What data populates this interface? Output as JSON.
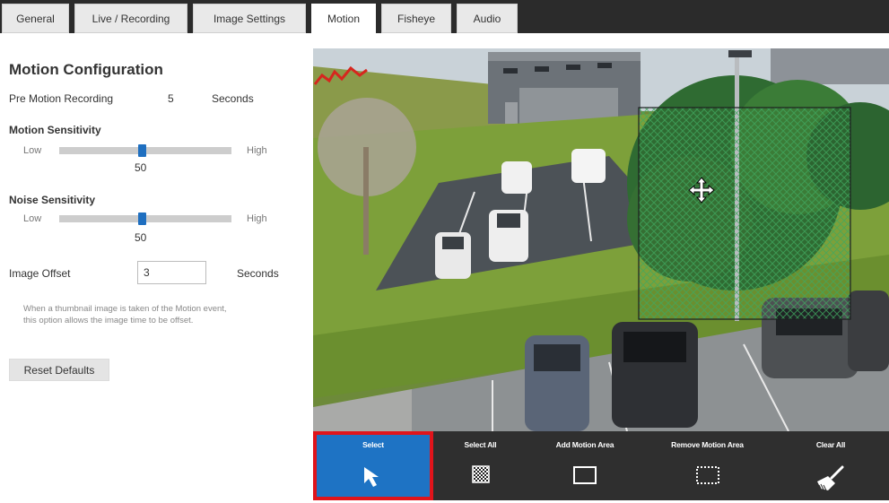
{
  "tabs": [
    {
      "label": "General",
      "active": false
    },
    {
      "label": "Live / Recording",
      "active": false
    },
    {
      "label": "Image Settings",
      "active": false
    },
    {
      "label": "Motion",
      "active": true
    },
    {
      "label": "Fisheye",
      "active": false
    },
    {
      "label": "Audio",
      "active": false
    }
  ],
  "panel": {
    "title": "Motion Configuration",
    "pre_motion": {
      "label": "Pre Motion Recording",
      "value": "5",
      "unit": "Seconds"
    },
    "motion_sensitivity": {
      "label": "Motion Sensitivity",
      "low": "Low",
      "high": "High",
      "value": "50",
      "level": 0.48
    },
    "noise_sensitivity": {
      "label": "Noise Sensitivity",
      "low": "Low",
      "high": "High",
      "value": "50",
      "level": 0.48
    },
    "image_offset": {
      "label": "Image Offset",
      "value": "3",
      "unit": "Seconds"
    },
    "help_text": "When a thumbnail image is taken of the Motion event, this option allows the image time to be offset.",
    "reset_label": "Reset Defaults"
  },
  "toolbar": {
    "tools": [
      {
        "label": "Select",
        "icon": "arrow-cursor-icon",
        "selected": true
      },
      {
        "label": "Select All",
        "icon": "checkered-grid-icon",
        "selected": false
      },
      {
        "label": "Add Motion Area",
        "icon": "solid-square-icon",
        "selected": false
      },
      {
        "label": "Remove Motion Area",
        "icon": "dashed-square-icon",
        "selected": false
      },
      {
        "label": "Clear All",
        "icon": "broom-icon",
        "selected": false
      }
    ]
  },
  "colors": {
    "accent": "#1e73c4",
    "selected_outline": "#e0141b",
    "motion_area": "#2e8b57",
    "toolbar_bg": "#2f2f2f"
  }
}
